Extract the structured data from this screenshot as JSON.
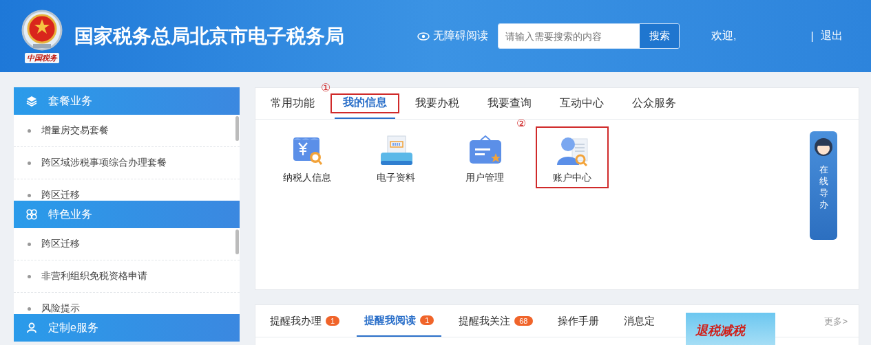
{
  "header": {
    "logo_caption": "中国税务",
    "title": "国家税务总局北京市电子税务局",
    "accessibility": "无障碍阅读",
    "search": {
      "placeholder": "请输入需要搜索的内容",
      "button": "搜索"
    },
    "welcome": "欢迎,",
    "separator": "|",
    "logout": "退出"
  },
  "sidebar": {
    "sections": [
      {
        "title": "套餐业务",
        "items": [
          "增量房交易套餐",
          "跨区域涉税事项综合办理套餐",
          "跨区迁移"
        ]
      },
      {
        "title": "特色业务",
        "items": [
          "跨区迁移",
          "非营利组织免税资格申请",
          "风险提示"
        ]
      },
      {
        "title": "定制e服务"
      }
    ]
  },
  "main": {
    "tabs": [
      {
        "label": "常用功能",
        "selected": false
      },
      {
        "label": "我的信息",
        "selected": true,
        "annotation": "①"
      },
      {
        "label": "我要办税",
        "selected": false
      },
      {
        "label": "我要查询",
        "selected": false
      },
      {
        "label": "互动中心",
        "selected": false
      },
      {
        "label": "公众服务",
        "selected": false
      }
    ],
    "items": [
      {
        "label": "纳税人信息",
        "kind": "taxpayer"
      },
      {
        "label": "电子资料",
        "kind": "printer"
      },
      {
        "label": "用户管理",
        "kind": "card"
      },
      {
        "label": "账户中心",
        "kind": "account",
        "annotation": "②"
      }
    ],
    "guide": {
      "label": "在线导办"
    }
  },
  "notices": {
    "tabs": [
      {
        "label": "提醒我办理",
        "badge": "1",
        "selected": false
      },
      {
        "label": "提醒我阅读",
        "badge": "1",
        "selected": true
      },
      {
        "label": "提醒我关注",
        "badge": "68",
        "selected": false
      },
      {
        "label": "操作手册",
        "selected": false
      },
      {
        "label": "消息定",
        "selected": false
      }
    ],
    "more": "更多>",
    "banner": {
      "text": "退税减税"
    }
  }
}
